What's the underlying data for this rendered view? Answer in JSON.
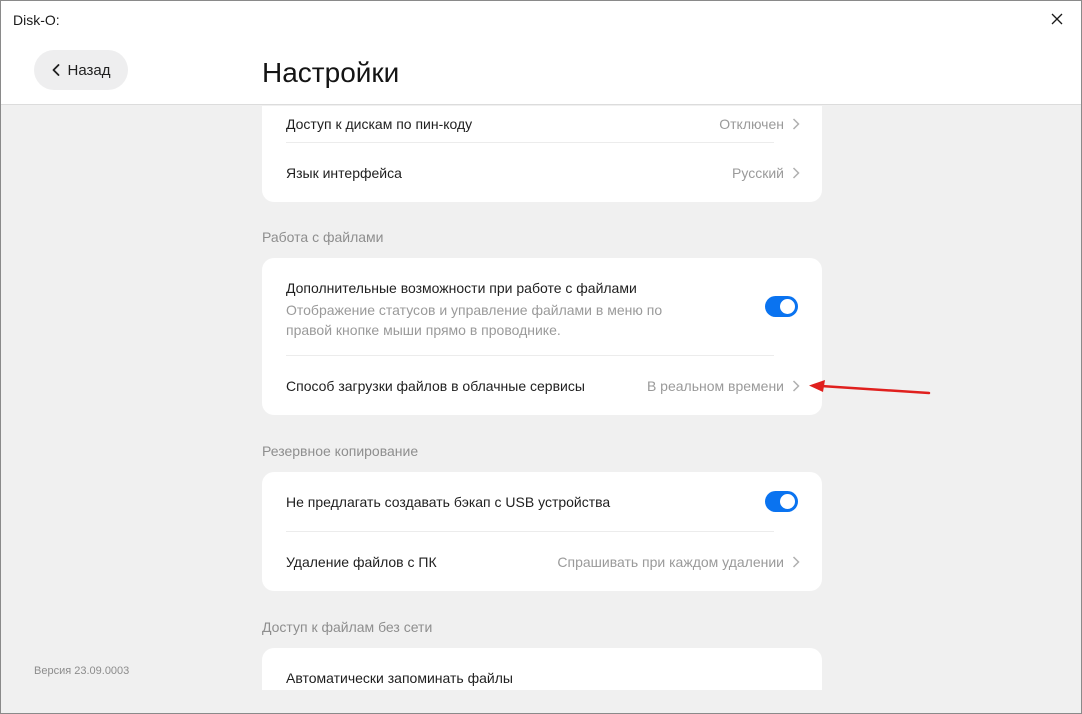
{
  "window": {
    "title": "Disk-O:"
  },
  "header": {
    "back_label": "Назад",
    "page_title": "Настройки"
  },
  "footer": {
    "version": "Версия 23.09.0003"
  },
  "general": {
    "rows": [
      {
        "label": "Доступ к дискам по пин-коду",
        "value": "Отключен"
      },
      {
        "label": "Язык интерфейса",
        "value": "Русский"
      }
    ]
  },
  "files_section": {
    "title": "Работа с файлами",
    "extended": {
      "label": "Дополнительные возможности при работе с файлами",
      "description": "Отображение статусов и управление файлами в меню по правой кнопке мыши прямо в проводнике.",
      "enabled": true
    },
    "upload_method": {
      "label": "Способ загрузки файлов в облачные сервисы",
      "value": "В реальном времени"
    }
  },
  "backup_section": {
    "title": "Резервное копирование",
    "no_usb_backup": {
      "label": "Не предлагать создавать бэкап с USB устройства",
      "enabled": true
    },
    "delete_files": {
      "label": "Удаление файлов с ПК",
      "value": "Спрашивать при каждом удалении"
    }
  },
  "offline_section": {
    "title": "Доступ к файлам без сети",
    "auto_remember": {
      "label": "Автоматически запоминать файлы"
    }
  },
  "colors": {
    "accent": "#0a73f0",
    "annotation_arrow": "#e0201e"
  }
}
